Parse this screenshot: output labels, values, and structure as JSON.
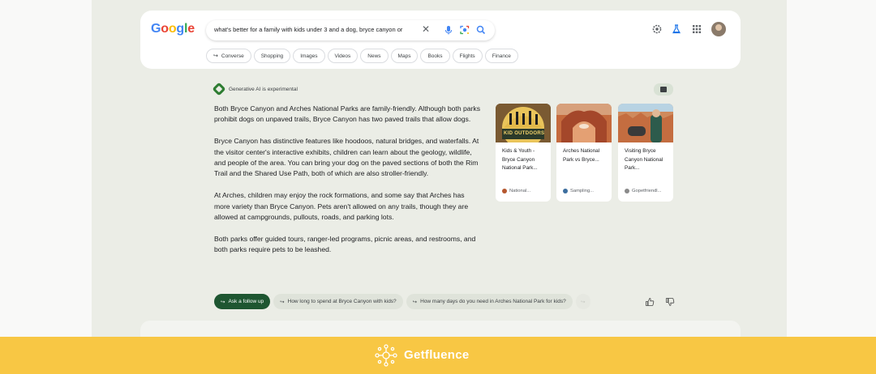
{
  "header": {
    "logo_letters": [
      "G",
      "o",
      "o",
      "g",
      "l",
      "e"
    ],
    "logo_colors": [
      "#4285f4",
      "#ea4335",
      "#fbbc05",
      "#4285f4",
      "#34a853",
      "#ea4335"
    ],
    "search_query": "what's better for a family with kids under 3 and a dog, bryce canyon or",
    "clear_icon": "close-icon",
    "icons": [
      "microphone-icon",
      "lens-icon",
      "search-icon",
      "settings-icon",
      "labs-flask-icon",
      "apps-grid-icon",
      "avatar"
    ]
  },
  "chips": [
    {
      "label": "Converse",
      "arrow": "↪"
    },
    {
      "label": "Shopping"
    },
    {
      "label": "Images"
    },
    {
      "label": "Videos"
    },
    {
      "label": "News"
    },
    {
      "label": "Maps"
    },
    {
      "label": "Books"
    },
    {
      "label": "Flights"
    },
    {
      "label": "Finance"
    }
  ],
  "ai": {
    "label": "Generative AI is experimental",
    "paragraphs": [
      "Both Bryce Canyon and Arches National Parks are family-friendly. Although both parks prohibit dogs on unpaved trails, Bryce Canyon has two paved trails that allow dogs.",
      "Bryce Canyon has distinctive features like hoodoos, natural bridges, and waterfalls. At the visitor center's interactive exhibits, children can learn about the geology, wildlife, and people of the area. You can bring your dog on the paved sections of both the Rim Trail and the Shared Use Path, both of which are also stroller-friendly.",
      "At Arches, children may enjoy the rock formations, and some say that Arches has more variety than Bryce Canyon. Pets aren't allowed on any trails, though they are allowed at campgrounds, pullouts, roads, and parking lots.",
      "Both parks offer guided tours, ranger-led programs, picnic areas, and restrooms, and both parks require pets to be leashed."
    ],
    "sources": [
      {
        "title": "Kids & Youth - Bryce Canyon National Park...",
        "site": "National...",
        "image_text": "KID OUTDOORS",
        "site_color": "#b5572f"
      },
      {
        "title": "Arches National Park vs Bryce...",
        "site": "Sampling...",
        "site_color": "#3c6e9e"
      },
      {
        "title": "Visiting Bryce Canyon National Park...",
        "site": "Gopetfriendl...",
        "site_color": "#8a8a8a"
      }
    ]
  },
  "followups": {
    "primary": "Ask a follow up",
    "suggestions": [
      "How long to spend at Bryce Canyon with kids?",
      "How many days do you need in Arches National Park for kids?"
    ],
    "arrow": "↪",
    "faded": "↪"
  },
  "footer": {
    "brand": "Getfluence",
    "background": "#f8c744"
  }
}
